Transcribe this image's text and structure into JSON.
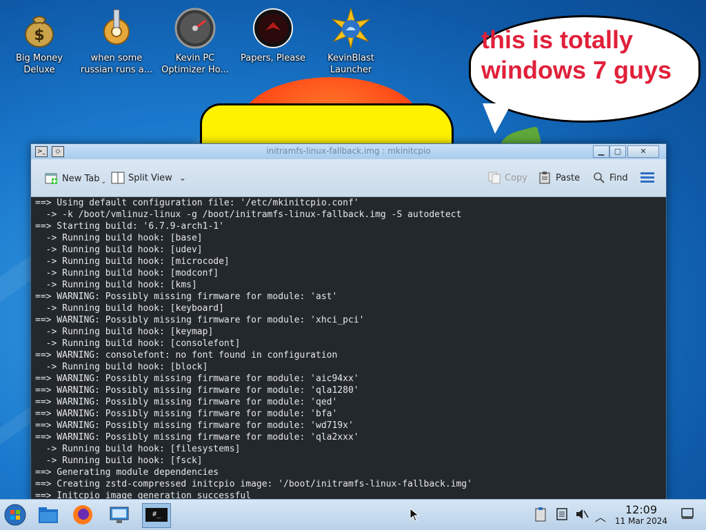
{
  "desktop": {
    "icons": [
      {
        "label": "Big Money Deluxe",
        "name": "big-money-deluxe"
      },
      {
        "label": "when some russian runs a...",
        "name": "russian-runs"
      },
      {
        "label": "Kevin PC Optimizer Ho...",
        "name": "kevin-pc-optimizer"
      },
      {
        "label": "Papers, Please",
        "name": "papers-please"
      },
      {
        "label": "KevinBlast Launcher",
        "name": "kevinblast-launcher"
      }
    ],
    "bubble_text": "this is totally windows 7 guys"
  },
  "window": {
    "title": "initramfs-linux-fallback.img : mkinitcpio",
    "toolbar": {
      "new_tab": "New Tab",
      "split_view": "Split View",
      "copy": "Copy",
      "paste": "Paste",
      "find": "Find"
    },
    "terminal_lines": [
      "==> Using default configuration file: '/etc/mkinitcpio.conf'",
      "  -> -k /boot/vmlinuz-linux -g /boot/initramfs-linux-fallback.img -S autodetect",
      "==> Starting build: '6.7.9-arch1-1'",
      "  -> Running build hook: [base]",
      "  -> Running build hook: [udev]",
      "  -> Running build hook: [microcode]",
      "  -> Running build hook: [modconf]",
      "  -> Running build hook: [kms]",
      "==> WARNING: Possibly missing firmware for module: 'ast'",
      "  -> Running build hook: [keyboard]",
      "==> WARNING: Possibly missing firmware for module: 'xhci_pci'",
      "  -> Running build hook: [keymap]",
      "  -> Running build hook: [consolefont]",
      "==> WARNING: consolefont: no font found in configuration",
      "  -> Running build hook: [block]",
      "==> WARNING: Possibly missing firmware for module: 'aic94xx'",
      "==> WARNING: Possibly missing firmware for module: 'qla1280'",
      "==> WARNING: Possibly missing firmware for module: 'qed'",
      "==> WARNING: Possibly missing firmware for module: 'bfa'",
      "==> WARNING: Possibly missing firmware for module: 'wd719x'",
      "==> WARNING: Possibly missing firmware for module: 'qla2xxx'",
      "  -> Running build hook: [filesystems]",
      "  -> Running build hook: [fsck]",
      "==> Generating module dependencies",
      "==> Creating zstd-compressed initcpio image: '/boot/initramfs-linux-fallback.img'",
      "==> Initcpio image generation successful"
    ]
  },
  "taskbar": {
    "time": "12:09",
    "date": "11 Mar 2024",
    "terminal_label": "#_"
  },
  "colors": {
    "terminal_bg": "#23282d",
    "terminal_fg": "#e8e8e8",
    "bubble_text": "#e0203a",
    "accent": "#2b6cc4"
  }
}
